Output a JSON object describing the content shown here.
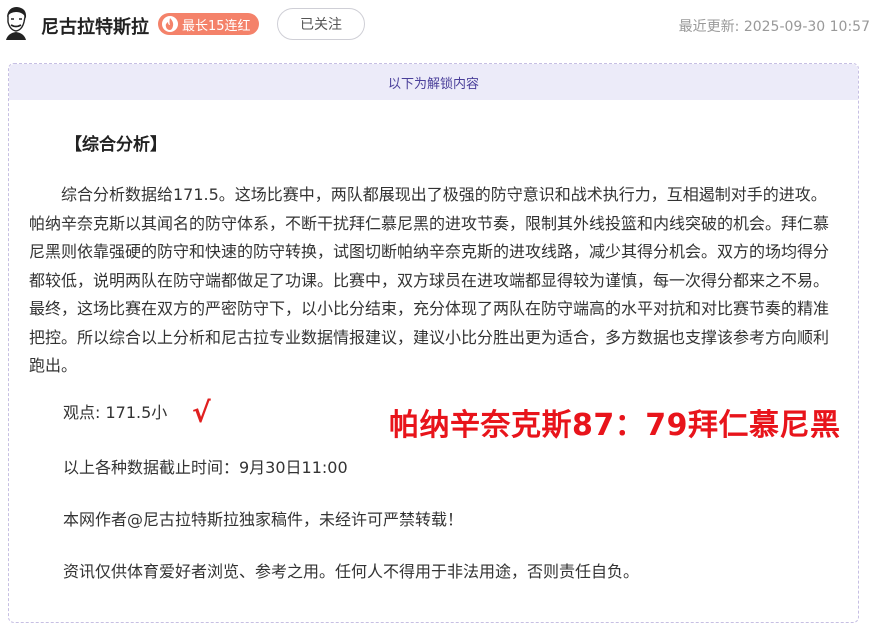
{
  "header": {
    "author_name": "尼古拉特斯拉",
    "streak_badge": "最长15连红",
    "follow_label": "已关注",
    "last_update_label": "最近更新:",
    "last_update_time": "2025-09-30 10:57"
  },
  "content": {
    "unlock_notice": "以下为解锁内容",
    "section_title": "【综合分析】",
    "analysis": "综合分析数据给171.5。这场比赛中，两队都展现出了极强的防守意识和战术执行力，互相遏制对手的进攻。帕纳辛奈克斯以其闻名的防守体系，不断干扰拜仁慕尼黑的进攻节奏，限制其外线投篮和内线突破的机会。拜仁慕尼黑则依靠强硬的防守和快速的防守转换，试图切断帕纳辛奈克斯的进攻线路，减少其得分机会。双方的场均得分都较低，说明两队在防守端都做足了功课。比赛中，双方球员在进攻端都显得较为谨慎，每一次得分都来之不易。最终，这场比赛在双方的严密防守下，以小比分结束，充分体现了两队在防守端高的水平对抗和对比赛节奏的精准把控。所以综合以上分析和尼古拉专业数据情报建议，建议小比分胜出更为适合，多方数据也支撑该参考方向顺利跑出。",
    "view_label": "观点:",
    "view_value": "171.5小",
    "check_mark": "√",
    "result": "帕纳辛奈克斯87：79拜仁慕尼黑",
    "cutoff": "以上各种数据截止时间：9月30日11:00",
    "copyright": "本网作者@尼古拉特斯拉独家稿件，未经许可严禁转载！",
    "disclaimer": "资讯仅供体育爱好者浏览、参考之用。任何人不得用于非法用途，否则责任自负。"
  },
  "colors": {
    "badge": "#f4826a",
    "result": "#e8141b",
    "unlock_bar": "#ecebf9",
    "unlock_text": "#4a3f9a"
  },
  "icons": {
    "avatar": "avatar-icon",
    "flame": "flame-icon"
  }
}
